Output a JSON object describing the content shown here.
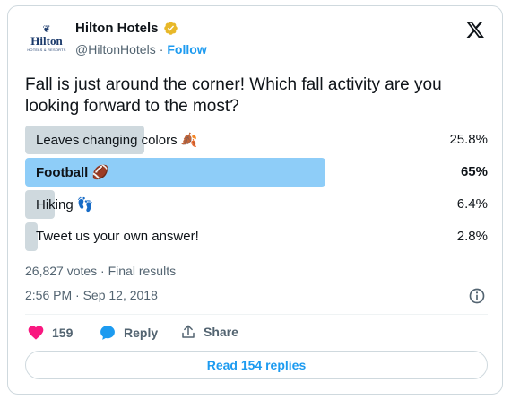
{
  "account": {
    "display_name": "Hilton Hotels",
    "handle": "@HiltonHotels",
    "separator": "·",
    "follow_label": "Follow",
    "avatar": {
      "crest": "❦",
      "brand": "Hilton",
      "sub": "HOTELS & RESORTS"
    },
    "verified_color": "#e8b829"
  },
  "tweet": {
    "text": "Fall is just around the corner! Which fall activity are you looking forward to the most?"
  },
  "poll": {
    "options": [
      {
        "label": "Leaves changing colors 🍂",
        "percent_label": "25.8%",
        "fraction": 0.258,
        "winner": false
      },
      {
        "label": "Football 🏈",
        "percent_label": "65%",
        "fraction": 0.65,
        "winner": true
      },
      {
        "label": "Hiking 👣",
        "percent_label": "6.4%",
        "fraction": 0.064,
        "winner": false
      },
      {
        "label": "Tweet us your own answer!",
        "percent_label": "2.8%",
        "fraction": 0.028,
        "winner": false
      }
    ],
    "meta": "26,827 votes · Final results"
  },
  "timestamp": "2:56 PM · Sep 12, 2018",
  "actions": {
    "like_count": "159",
    "reply_label": "Reply",
    "share_label": "Share"
  },
  "read_replies_label": "Read 154 replies",
  "colors": {
    "accent": "#1d9bf0",
    "like": "#f91880",
    "winner_bar": "#8ecdf8",
    "bar": "#cfd9de"
  },
  "icons": [
    "x-logo-icon",
    "verified-badge-icon",
    "info-icon",
    "heart-icon",
    "reply-bubble-icon",
    "share-icon"
  ]
}
